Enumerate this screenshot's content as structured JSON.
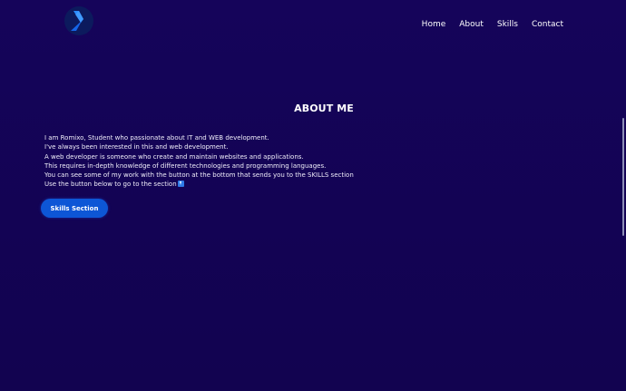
{
  "header": {
    "logo_icon": "chevron-logo-icon",
    "nav": {
      "home": "Home",
      "about": "About",
      "skills": "Skills",
      "contact": "Contact"
    }
  },
  "about": {
    "title": "ABOUT ME",
    "lines": [
      "I am Romixo, Student who passionate about IT and WEB development.",
      "I've always been interested in this and web development.",
      "A web developer is someone who create and maintain websites and applications.",
      "This requires in-depth knowledge of different technologies and programming languages.",
      "You can see some of my work with the button at the bottom that sends you to the SKILLS section",
      "Use the button below to go to the section"
    ],
    "arrow_icon": "down-arrow-emoji-icon",
    "button_label": "Skills Section"
  },
  "colors": {
    "background": "#140357",
    "button": "#0d56d6",
    "logo_primary": "#1f7bff",
    "logo_dark": "#0b1f5e"
  }
}
